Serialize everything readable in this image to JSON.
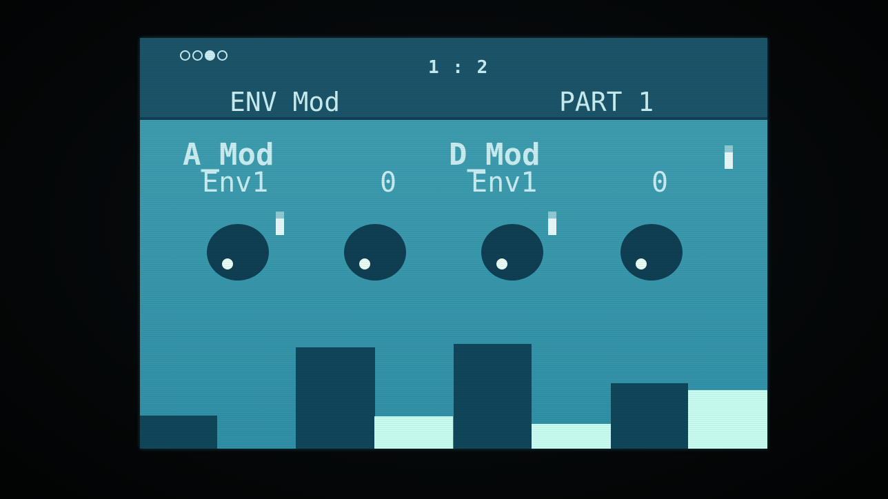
{
  "header": {
    "position": "1 : 2",
    "page_title": "ENV Mod",
    "part": "PART 1",
    "page_dots": [
      false,
      false,
      true,
      false
    ]
  },
  "params": [
    {
      "name": "A_Mod",
      "source": "Env1",
      "value": "0"
    },
    {
      "name": "D_Mod",
      "source": "Env1",
      "value": "0"
    }
  ],
  "knobs": [
    {
      "name": "knob-1"
    },
    {
      "name": "knob-2"
    },
    {
      "name": "knob-3"
    },
    {
      "name": "knob-4"
    }
  ],
  "colors": {
    "screen": "#3b9aad",
    "header": "#1b5468",
    "text": "#c8ecef",
    "dark_bar": "#0f4659",
    "light_bar": "#c8fbef"
  }
}
